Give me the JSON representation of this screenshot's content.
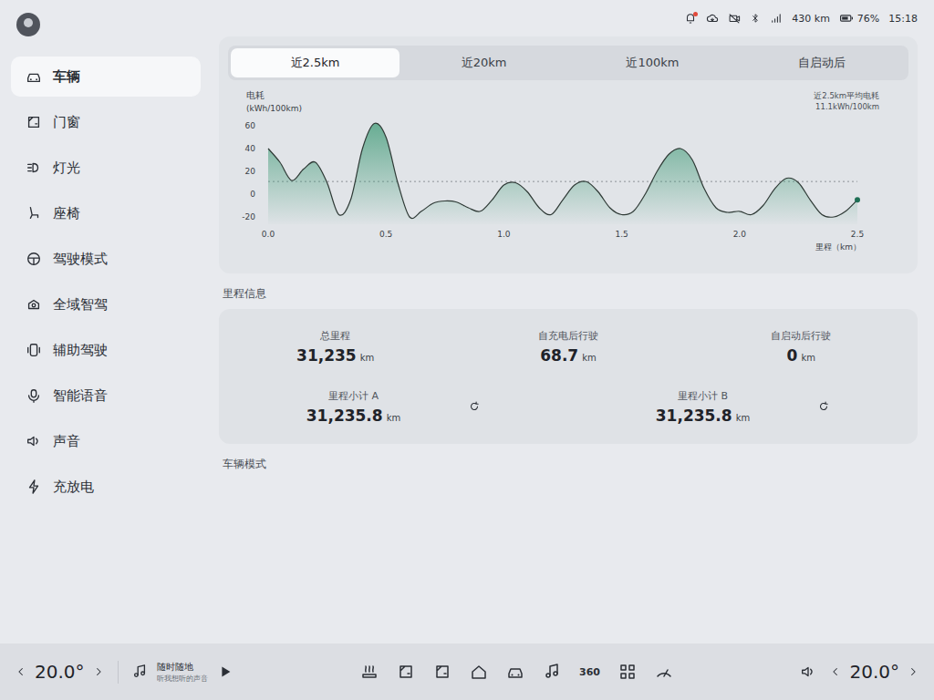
{
  "status_bar": {
    "notification_dot": true,
    "range": "430 km",
    "battery": "76%",
    "time": "15:18"
  },
  "sidebar": {
    "items": [
      {
        "label": "车辆",
        "selected": true
      },
      {
        "label": "门窗",
        "selected": false
      },
      {
        "label": "灯光",
        "selected": false
      },
      {
        "label": "座椅",
        "selected": false
      },
      {
        "label": "驾驶模式",
        "selected": false
      },
      {
        "label": "全域智驾",
        "selected": false
      },
      {
        "label": "辅助驾驶",
        "selected": false
      },
      {
        "label": "智能语音",
        "selected": false
      },
      {
        "label": "声音",
        "selected": false
      },
      {
        "label": "充放电",
        "selected": false
      }
    ]
  },
  "chart": {
    "tabs": [
      {
        "label": "近2.5km",
        "selected": true
      },
      {
        "label": "近20km",
        "selected": false
      },
      {
        "label": "近100km",
        "selected": false
      },
      {
        "label": "自启动后",
        "selected": false
      }
    ],
    "y_label": "电耗",
    "y_unit": "(kWh/100km)",
    "y_ticks": [
      "60",
      "40",
      "20",
      "0",
      "-20"
    ],
    "x_ticks": [
      "0.0",
      "0.5",
      "1.0",
      "1.5",
      "2.0",
      "2.5"
    ],
    "x_label": "里程（km）",
    "note": [
      "近2.5km平均电耗",
      "11.1kWh/100km"
    ],
    "average": 11.1,
    "series": [
      {
        "values": [
          40,
          28,
          12,
          22,
          28,
          10,
          -18,
          -5,
          40,
          62,
          50,
          10,
          -20,
          -15,
          -8,
          -6,
          -7,
          -12,
          -15,
          -5,
          8,
          10,
          2,
          -12,
          -18,
          -5,
          8,
          11,
          2,
          -12,
          -18,
          -15,
          0,
          20,
          35,
          40,
          30,
          5,
          -12,
          -16,
          -15,
          -18,
          -10,
          5,
          14,
          10,
          -5,
          -18,
          -20,
          -15,
          -5
        ]
      }
    ]
  },
  "mileage": {
    "title": "里程信息",
    "cards": [
      {
        "kind": "stat",
        "label": "总里程",
        "value": "31,235",
        "unit": "km"
      },
      {
        "kind": "stat",
        "label": "自充电后行驶",
        "value": "68.7",
        "unit": "km"
      },
      {
        "kind": "stat",
        "label": "自启动后行驶",
        "value": "0",
        "unit": "km"
      },
      {
        "kind": "trip",
        "label": "里程小计 A",
        "value": "31,235.8",
        "unit": "km"
      },
      {
        "kind": "trip",
        "label": "里程小计 B",
        "value": "31,235.8",
        "unit": "km"
      }
    ]
  },
  "vehicle_mode": {
    "title": "车辆模式"
  },
  "dock": {
    "left_temp": "20.0°",
    "right_temp": "20.0°",
    "media": {
      "title": "随时随地",
      "subtitle": "听我想听的声音"
    },
    "view_360": "360"
  }
}
